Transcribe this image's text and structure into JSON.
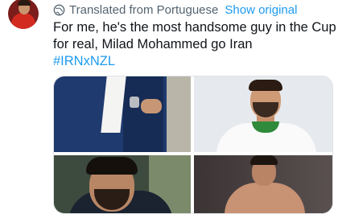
{
  "tweet": {
    "translated_label": "Translated from Portuguese",
    "show_original_label": "Show original",
    "text_lines": [
      "For me, he's the most handsome guy in the Cup",
      "for real, Milad Mohammed go Iran"
    ],
    "hashtag": "#IRNxNZL"
  },
  "icons": {
    "translate": "globe-icon"
  },
  "colors": {
    "link": "#1d9bf0",
    "secondary_text": "#536471",
    "primary_text": "#0f1419"
  }
}
